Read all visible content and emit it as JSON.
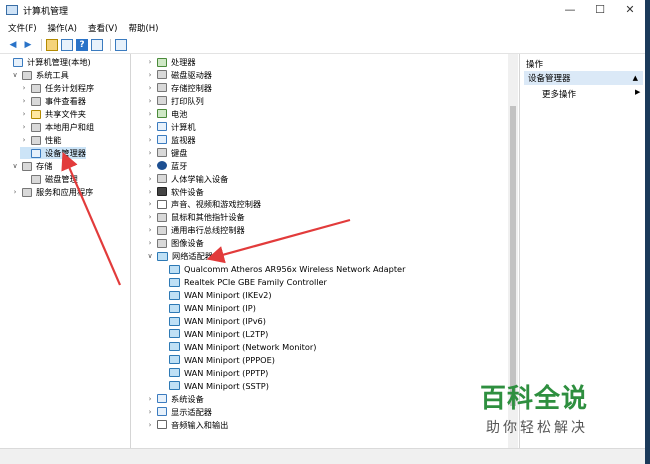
{
  "window": {
    "title": "计算机管理",
    "controls": [
      "—",
      "☐",
      "✕"
    ]
  },
  "menu": [
    "文件(F)",
    "操作(A)",
    "查看(V)",
    "帮助(H)"
  ],
  "left_tree": [
    {
      "label": "计算机管理(本地)",
      "indent": 0,
      "chev": "",
      "icon": "mon"
    },
    {
      "label": "系统工具",
      "indent": 1,
      "chev": "∨",
      "icon": "gray"
    },
    {
      "label": "任务计划程序",
      "indent": 2,
      "chev": "›",
      "icon": "gray"
    },
    {
      "label": "事件查看器",
      "indent": 2,
      "chev": "›",
      "icon": "gray"
    },
    {
      "label": "共享文件夹",
      "indent": 2,
      "chev": "›",
      "icon": "yellow"
    },
    {
      "label": "本地用户和组",
      "indent": 2,
      "chev": "›",
      "icon": "gray"
    },
    {
      "label": "性能",
      "indent": 2,
      "chev": "›",
      "icon": "gray"
    },
    {
      "label": "设备管理器",
      "indent": 2,
      "chev": "",
      "icon": "mon",
      "selected": true
    },
    {
      "label": "存储",
      "indent": 1,
      "chev": "∨",
      "icon": "gray"
    },
    {
      "label": "磁盘管理",
      "indent": 2,
      "chev": "",
      "icon": "gray"
    },
    {
      "label": "服务和应用程序",
      "indent": 1,
      "chev": "›",
      "icon": "gray"
    }
  ],
  "device_tree": [
    {
      "label": "处理器",
      "indent": 0,
      "chev": "›",
      "icon": "green"
    },
    {
      "label": "磁盘驱动器",
      "indent": 0,
      "chev": "›",
      "icon": "gray"
    },
    {
      "label": "存储控制器",
      "indent": 0,
      "chev": "›",
      "icon": "gray"
    },
    {
      "label": "打印队列",
      "indent": 0,
      "chev": "›",
      "icon": "gray"
    },
    {
      "label": "电池",
      "indent": 0,
      "chev": "›",
      "icon": "green"
    },
    {
      "label": "计算机",
      "indent": 0,
      "chev": "›",
      "icon": "mon"
    },
    {
      "label": "监视器",
      "indent": 0,
      "chev": "›",
      "icon": "mon"
    },
    {
      "label": "键盘",
      "indent": 0,
      "chev": "›",
      "icon": "gray"
    },
    {
      "label": "蓝牙",
      "indent": 0,
      "chev": "›",
      "icon": "bt"
    },
    {
      "label": "人体学输入设备",
      "indent": 0,
      "chev": "›",
      "icon": "gray"
    },
    {
      "label": "软件设备",
      "indent": 0,
      "chev": "›",
      "icon": "dark"
    },
    {
      "label": "声音、视频和游戏控制器",
      "indent": 0,
      "chev": "›",
      "icon": "audio"
    },
    {
      "label": "鼠标和其他指针设备",
      "indent": 0,
      "chev": "›",
      "icon": "gray"
    },
    {
      "label": "通用串行总线控制器",
      "indent": 0,
      "chev": "›",
      "icon": "gray"
    },
    {
      "label": "图像设备",
      "indent": 0,
      "chev": "›",
      "icon": "gray"
    },
    {
      "label": "网络适配器",
      "indent": 0,
      "chev": "∨",
      "icon": "net"
    },
    {
      "label": "Qualcomm Atheros AR956x Wireless Network Adapter",
      "indent": 1,
      "chev": "",
      "icon": "net"
    },
    {
      "label": "Realtek PCIe GBE Family Controller",
      "indent": 1,
      "chev": "",
      "icon": "net"
    },
    {
      "label": "WAN Miniport (IKEv2)",
      "indent": 1,
      "chev": "",
      "icon": "net"
    },
    {
      "label": "WAN Miniport (IP)",
      "indent": 1,
      "chev": "",
      "icon": "net"
    },
    {
      "label": "WAN Miniport (IPv6)",
      "indent": 1,
      "chev": "",
      "icon": "net"
    },
    {
      "label": "WAN Miniport (L2TP)",
      "indent": 1,
      "chev": "",
      "icon": "net"
    },
    {
      "label": "WAN Miniport (Network Monitor)",
      "indent": 1,
      "chev": "",
      "icon": "net"
    },
    {
      "label": "WAN Miniport (PPPOE)",
      "indent": 1,
      "chev": "",
      "icon": "net"
    },
    {
      "label": "WAN Miniport (PPTP)",
      "indent": 1,
      "chev": "",
      "icon": "net"
    },
    {
      "label": "WAN Miniport (SSTP)",
      "indent": 1,
      "chev": "",
      "icon": "net"
    },
    {
      "label": "系统设备",
      "indent": 0,
      "chev": "›",
      "icon": "mon"
    },
    {
      "label": "显示适配器",
      "indent": 0,
      "chev": "›",
      "icon": "mon"
    },
    {
      "label": "音频输入和输出",
      "indent": 0,
      "chev": "›",
      "icon": "audio"
    }
  ],
  "actions": {
    "header": "操作",
    "section": "设备管理器",
    "more": "更多操作"
  },
  "watermark": {
    "main": "百科全说",
    "sub": "助你轻松解决"
  }
}
